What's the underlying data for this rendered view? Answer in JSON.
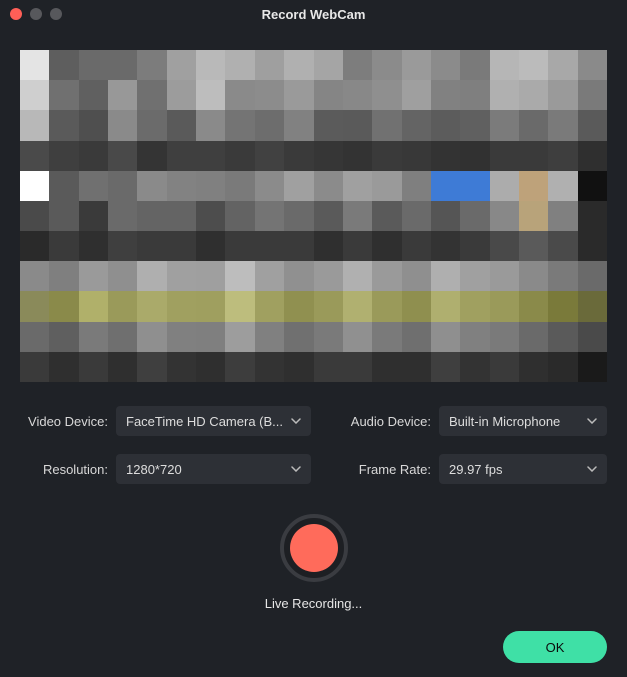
{
  "window": {
    "title": "Record WebCam"
  },
  "fields": {
    "video_device": {
      "label": "Video Device:",
      "value": "FaceTime HD Camera (B..."
    },
    "audio_device": {
      "label": "Audio Device:",
      "value": "Built-in Microphone"
    },
    "resolution": {
      "label": "Resolution:",
      "value": "1280*720"
    },
    "frame_rate": {
      "label": "Frame Rate:",
      "value": "29.97 fps"
    }
  },
  "record": {
    "status": "Live Recording..."
  },
  "buttons": {
    "ok": "OK"
  },
  "preview_pixels": [
    [
      "#e4e4e4",
      "#5e5e5e",
      "#6a6a6a",
      "#6a6a6a",
      "#7c7c7c",
      "#a0a0a0",
      "#b9b9b9",
      "#b0b0b0",
      "#9f9f9f",
      "#b0b0b0",
      "#a5a5a5",
      "#7d7d7d",
      "#8b8b8b",
      "#9a9a9a",
      "#8b8b8b",
      "#7a7a7a",
      "#b6b6b6",
      "#bbbbbb",
      "#a8a8a8",
      "#8a8a8a"
    ],
    [
      "#cfcfcf",
      "#707070",
      "#606060",
      "#989898",
      "#707070",
      "#9c9c9c",
      "#bdbdbd",
      "#8a8a8a",
      "#8c8c8c",
      "#9a9a9a",
      "#858585",
      "#888888",
      "#8f8f8f",
      "#9f9f9f",
      "#818181",
      "#7f7f7f",
      "#b0b0b0",
      "#aaaaaa",
      "#9a9a9a",
      "#7a7a7a"
    ],
    [
      "#b8b8b8",
      "#5a5a5a",
      "#4f4f4f",
      "#8a8a8a",
      "#6b6b6b",
      "#5a5a5a",
      "#8a8a8a",
      "#747474",
      "#6d6d6d",
      "#818181",
      "#5b5b5b",
      "#5a5a5a",
      "#717171",
      "#646464",
      "#5c5c5c",
      "#606060",
      "#7b7b7b",
      "#6a6a6a",
      "#7a7a7a",
      "#5a5a5a"
    ],
    [
      "#4a4a4a",
      "#3f3f3f",
      "#3a3a3a",
      "#494949",
      "#343434",
      "#3f3f3f",
      "#3f3f3f",
      "#3a3a3a",
      "#414141",
      "#3a3a3a",
      "#363636",
      "#333333",
      "#3a3a3a",
      "#383838",
      "#333333",
      "#313131",
      "#3a3a3a",
      "#3a3a3a",
      "#3e3e3e",
      "#2f2f2f"
    ],
    [
      "#ffffff",
      "#5a5a5a",
      "#707070",
      "#6a6a6a",
      "#8a8a8a",
      "#828282",
      "#808080",
      "#7a7a7a",
      "#8b8b8b",
      "#a0a0a0",
      "#8b8b8b",
      "#a0a0a0",
      "#9a9a9a",
      "#7f7f7f",
      "#3e7bd6",
      "#3e7bd6",
      "#acacac",
      "#bea27a",
      "#b0b0b0",
      "#111111"
    ],
    [
      "#4a4a4a",
      "#5a5a5a",
      "#3a3a3a",
      "#6a6a6a",
      "#646464",
      "#646464",
      "#4d4d4d",
      "#636363",
      "#747474",
      "#6a6a6a",
      "#5a5a5a",
      "#7a7a7a",
      "#5a5a5a",
      "#6a6a6a",
      "#555555",
      "#6a6a6a",
      "#888888",
      "#b8a37a",
      "#808080",
      "#2a2a2a"
    ],
    [
      "#2a2a2a",
      "#3a3a3a",
      "#2f2f2f",
      "#3f3f3f",
      "#3a3a3a",
      "#3a3a3a",
      "#2f2f2f",
      "#3a3a3a",
      "#3a3a3a",
      "#3a3a3a",
      "#2f2f2f",
      "#3a3a3a",
      "#2f2f2f",
      "#3a3a3a",
      "#333333",
      "#3a3a3a",
      "#494949",
      "#5a5a5a",
      "#4a4a4a",
      "#2a2a2a"
    ],
    [
      "#8a8a8a",
      "#7f7f7f",
      "#9a9a9a",
      "#8f8f8f",
      "#afafaf",
      "#a0a0a0",
      "#9f9f9f",
      "#bdbdbd",
      "#a0a0a0",
      "#909090",
      "#9a9a9a",
      "#b0b0b0",
      "#9a9a9a",
      "#8f8f8f",
      "#afafaf",
      "#a0a0a0",
      "#9a9a9a",
      "#8a8a8a",
      "#7a7a7a",
      "#6a6a6a"
    ],
    [
      "#8a8a5a",
      "#8a8a4a",
      "#b0b06a",
      "#9a9a5a",
      "#aaaa6a",
      "#a0a060",
      "#9f9f5f",
      "#bdbd7d",
      "#a0a060",
      "#909050",
      "#9a9a5a",
      "#b0b070",
      "#9a9a5a",
      "#8f8f4f",
      "#afaf6f",
      "#a0a060",
      "#9a9a5a",
      "#8a8a4a",
      "#7a7a3a",
      "#6a6a3a"
    ],
    [
      "#6a6a6a",
      "#5f5f5f",
      "#7a7a7a",
      "#6f6f6f",
      "#8f8f8f",
      "#808080",
      "#7f7f7f",
      "#9d9d9d",
      "#808080",
      "#707070",
      "#7a7a7a",
      "#909090",
      "#7a7a7a",
      "#6f6f6f",
      "#8f8f8f",
      "#808080",
      "#7a7a7a",
      "#6a6a6a",
      "#5a5a5a",
      "#4a4a4a"
    ],
    [
      "#3a3a3a",
      "#2f2f2f",
      "#3a3a3a",
      "#2f2f2f",
      "#3f3f3f",
      "#333333",
      "#2f2f2f",
      "#3d3d3d",
      "#333333",
      "#2f2f2f",
      "#3a3a3a",
      "#3a3a3a",
      "#2f2f2f",
      "#2f2f2f",
      "#3f3f3f",
      "#333333",
      "#3a3a3a",
      "#2f2f2f",
      "#2a2a2a",
      "#1a1a1a"
    ]
  ]
}
